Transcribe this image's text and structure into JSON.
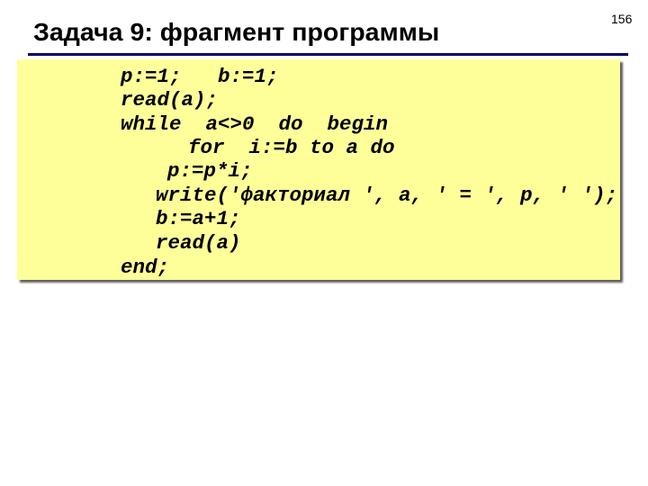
{
  "slide": {
    "number": "156",
    "title": "Задача 9: фрагмент программы"
  },
  "colors": {
    "title_rule": "#000066",
    "code_background": "#ffff99"
  },
  "code": {
    "language": "Pascal",
    "lines": [
      "p:=1;   b:=1;",
      "read(a);",
      "while  a<>0  do  begin",
      "for  i:=b to a do",
      "p:=p*i;",
      "write('факториал ', a, ' = ', p, ' ');",
      "b:=a+1;",
      "read(a)",
      "end;"
    ]
  }
}
